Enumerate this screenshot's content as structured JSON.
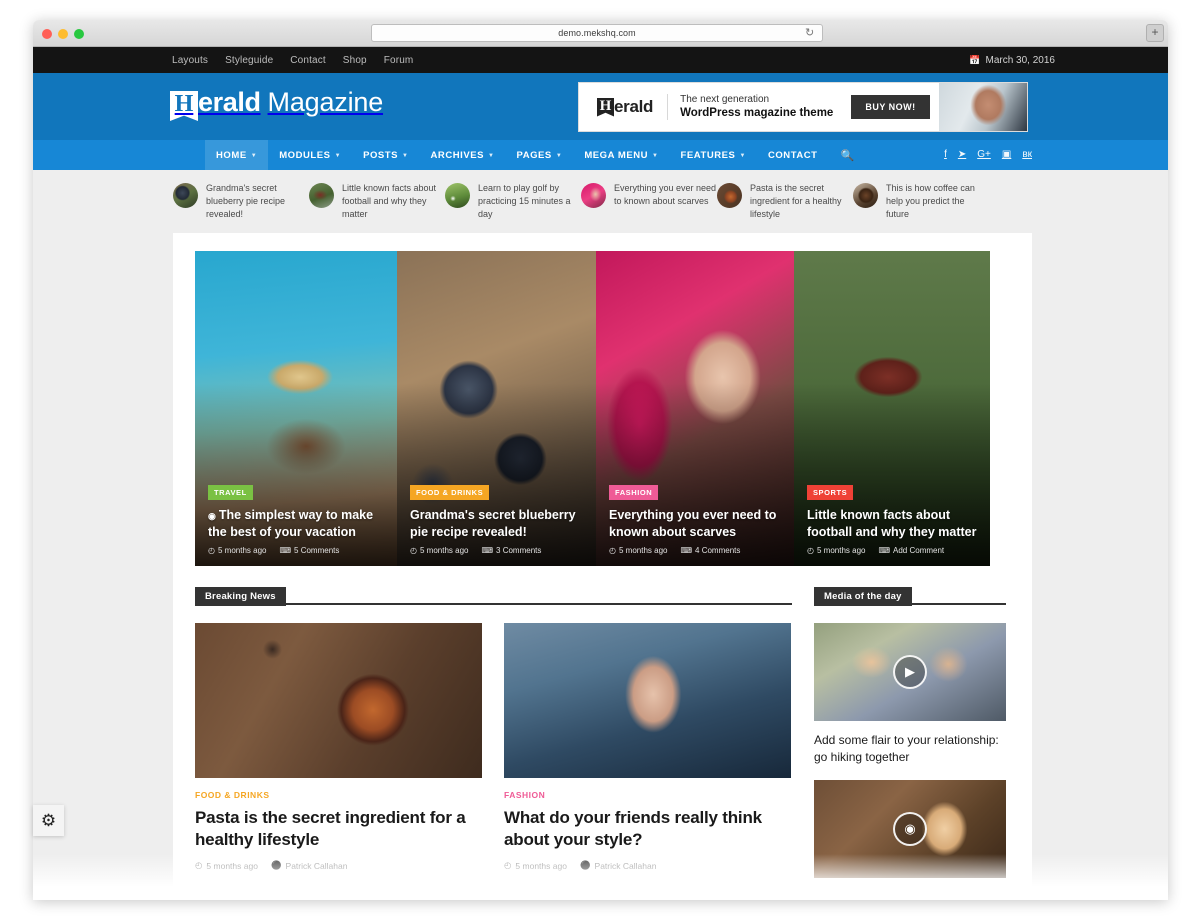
{
  "browser": {
    "url": "demo.mekshq.com",
    "reload_icon": "reload-icon",
    "new_tab_icon": "plus-icon"
  },
  "topbar": {
    "links": [
      "Layouts",
      "Styleguide",
      "Contact",
      "Shop",
      "Forum"
    ],
    "date": "March 30, 2016",
    "date_icon": "calendar-icon"
  },
  "header": {
    "logo_mark": "H",
    "logo_bold": "erald",
    "logo_light": "Magazine",
    "ad": {
      "logo_mark": "H",
      "logo_text": "erald",
      "line1": "The next generation",
      "line2": "WordPress magazine theme",
      "button": "BUY NOW!"
    }
  },
  "nav": {
    "items": [
      {
        "label": "HOME",
        "caret": true,
        "active": true
      },
      {
        "label": "MODULES",
        "caret": true,
        "active": false
      },
      {
        "label": "POSTS",
        "caret": true,
        "active": false
      },
      {
        "label": "ARCHIVES",
        "caret": true,
        "active": false
      },
      {
        "label": "PAGES",
        "caret": true,
        "active": false
      },
      {
        "label": "MEGA MENU",
        "caret": true,
        "active": false
      },
      {
        "label": "FEATURES",
        "caret": true,
        "active": false
      },
      {
        "label": "CONTACT",
        "caret": false,
        "active": false
      }
    ],
    "search_icon": "search-icon",
    "social": [
      {
        "name": "facebook-icon",
        "glyph": "f"
      },
      {
        "name": "twitter-icon",
        "glyph": "➤"
      },
      {
        "name": "google-plus-icon",
        "glyph": "G+"
      },
      {
        "name": "instagram-icon",
        "glyph": "▣"
      },
      {
        "name": "vk-icon",
        "glyph": "вк"
      }
    ]
  },
  "trending": [
    {
      "title": "Grandma's secret blueberry pie recipe revealed!",
      "thumb": "img-blueberry"
    },
    {
      "title": "Little known facts about football and why they matter",
      "thumb": "img-sports"
    },
    {
      "title": "Learn to play golf by practicing 15 minutes a day",
      "thumb": "img-golf"
    },
    {
      "title": "Everything you ever need to known about scarves",
      "thumb": "img-fashion"
    },
    {
      "title": "Pasta is the secret ingredient for a healthy lifestyle",
      "thumb": "img-pasta"
    },
    {
      "title": "This is how coffee can help you predict the future",
      "thumb": "img-coffee"
    }
  ],
  "hero": [
    {
      "category": "TRAVEL",
      "category_color": "#7ac143",
      "title": "The simplest way to make the best of your vacation",
      "date": "5 months ago",
      "comments": "5 Comments",
      "has_camera_icon": true,
      "image_class": "img-travel"
    },
    {
      "category": "FOOD & DRINKS",
      "category_color": "#f5a623",
      "title": "Grandma's secret blueberry pie recipe revealed!",
      "date": "5 months ago",
      "comments": "3 Comments",
      "has_camera_icon": false,
      "image_class": "img-blueberry"
    },
    {
      "category": "FASHION",
      "category_color": "#ef5b96",
      "title": "Everything you ever need to known about scarves",
      "date": "5 months ago",
      "comments": "4 Comments",
      "has_camera_icon": false,
      "image_class": "img-fashion"
    },
    {
      "category": "SPORTS",
      "category_color": "#ef4136",
      "title": "Little known facts about football and why they matter",
      "date": "5 months ago",
      "comments": "Add Comment",
      "has_camera_icon": false,
      "image_class": "img-sports"
    }
  ],
  "sections": {
    "breaking_news_label": "Breaking News",
    "media_of_the_day_label": "Media of the day"
  },
  "breaking_news": [
    {
      "category": "FOOD & DRINKS",
      "category_color": "#f5a623",
      "title": "Pasta is the secret ingredient for a healthy lifestyle",
      "date": "5 months ago",
      "author": "Patrick Callahan",
      "image_class": "img-pasta"
    },
    {
      "category": "FASHION",
      "category_color": "#ef5b96",
      "title": "What do your friends really think about your style?",
      "date": "5 months ago",
      "author": "Patrick Callahan",
      "image_class": "img-fashion2"
    }
  ],
  "media_of_the_day": [
    {
      "title": "Add some flair to your relationship: go hiking together",
      "badge_icon": "play-icon",
      "badge_glyph": "▶",
      "image_class": "img-hiking"
    },
    {
      "title": "",
      "badge_icon": "camera-icon",
      "badge_glyph": "◉",
      "image_class": "img-blonde"
    }
  ],
  "icons": {
    "clock": "clock-icon",
    "comment": "comment-icon",
    "author": "user-icon",
    "camera": "camera-icon",
    "gear": "gear-icon"
  },
  "colors": {
    "header_blue": "#1176bc",
    "nav_blue": "#1787d6",
    "topbar_black": "#141414",
    "section_bar": "#333333",
    "page_bg": "#eeeeee"
  }
}
